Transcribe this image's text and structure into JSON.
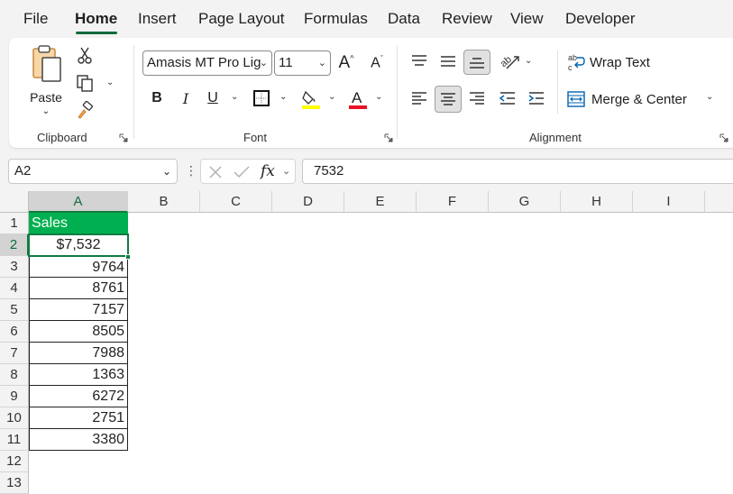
{
  "menu": {
    "tabs": [
      {
        "label": "File"
      },
      {
        "label": "Home"
      },
      {
        "label": "Insert"
      },
      {
        "label": "Page Layout"
      },
      {
        "label": "Formulas"
      },
      {
        "label": "Data"
      },
      {
        "label": "Review"
      },
      {
        "label": "View"
      },
      {
        "label": "Developer"
      }
    ],
    "active": "Home"
  },
  "ribbon": {
    "clipboard": {
      "label": "Clipboard",
      "paste_label": "Paste"
    },
    "font": {
      "label": "Font",
      "font_name": "Amasis MT Pro Lig",
      "font_size": "11",
      "bold": "B",
      "italic": "I",
      "underline": "U",
      "highlight_color": "#ffff00",
      "font_color": "#e81123"
    },
    "alignment": {
      "label": "Alignment",
      "wrap_text": "Wrap Text",
      "merge_center": "Merge & Center"
    }
  },
  "formula_bar": {
    "name_box": "A2",
    "fx": "fx",
    "value": "7532"
  },
  "sheet": {
    "columns": [
      "A",
      "B",
      "C",
      "D",
      "E",
      "F",
      "G",
      "H",
      "I"
    ],
    "rows": [
      "1",
      "2",
      "3",
      "4",
      "5",
      "6",
      "7",
      "8",
      "9",
      "10",
      "11",
      "12",
      "13"
    ],
    "header_cell": "Sales",
    "header_fill": "#00b050",
    "selected_cell": "A2",
    "cells": [
      "$7,532",
      "9764",
      "8761",
      "7157",
      "8505",
      "7988",
      "1363",
      "6272",
      "2751",
      "3380"
    ]
  },
  "colors": {
    "accent": "#107c41"
  }
}
